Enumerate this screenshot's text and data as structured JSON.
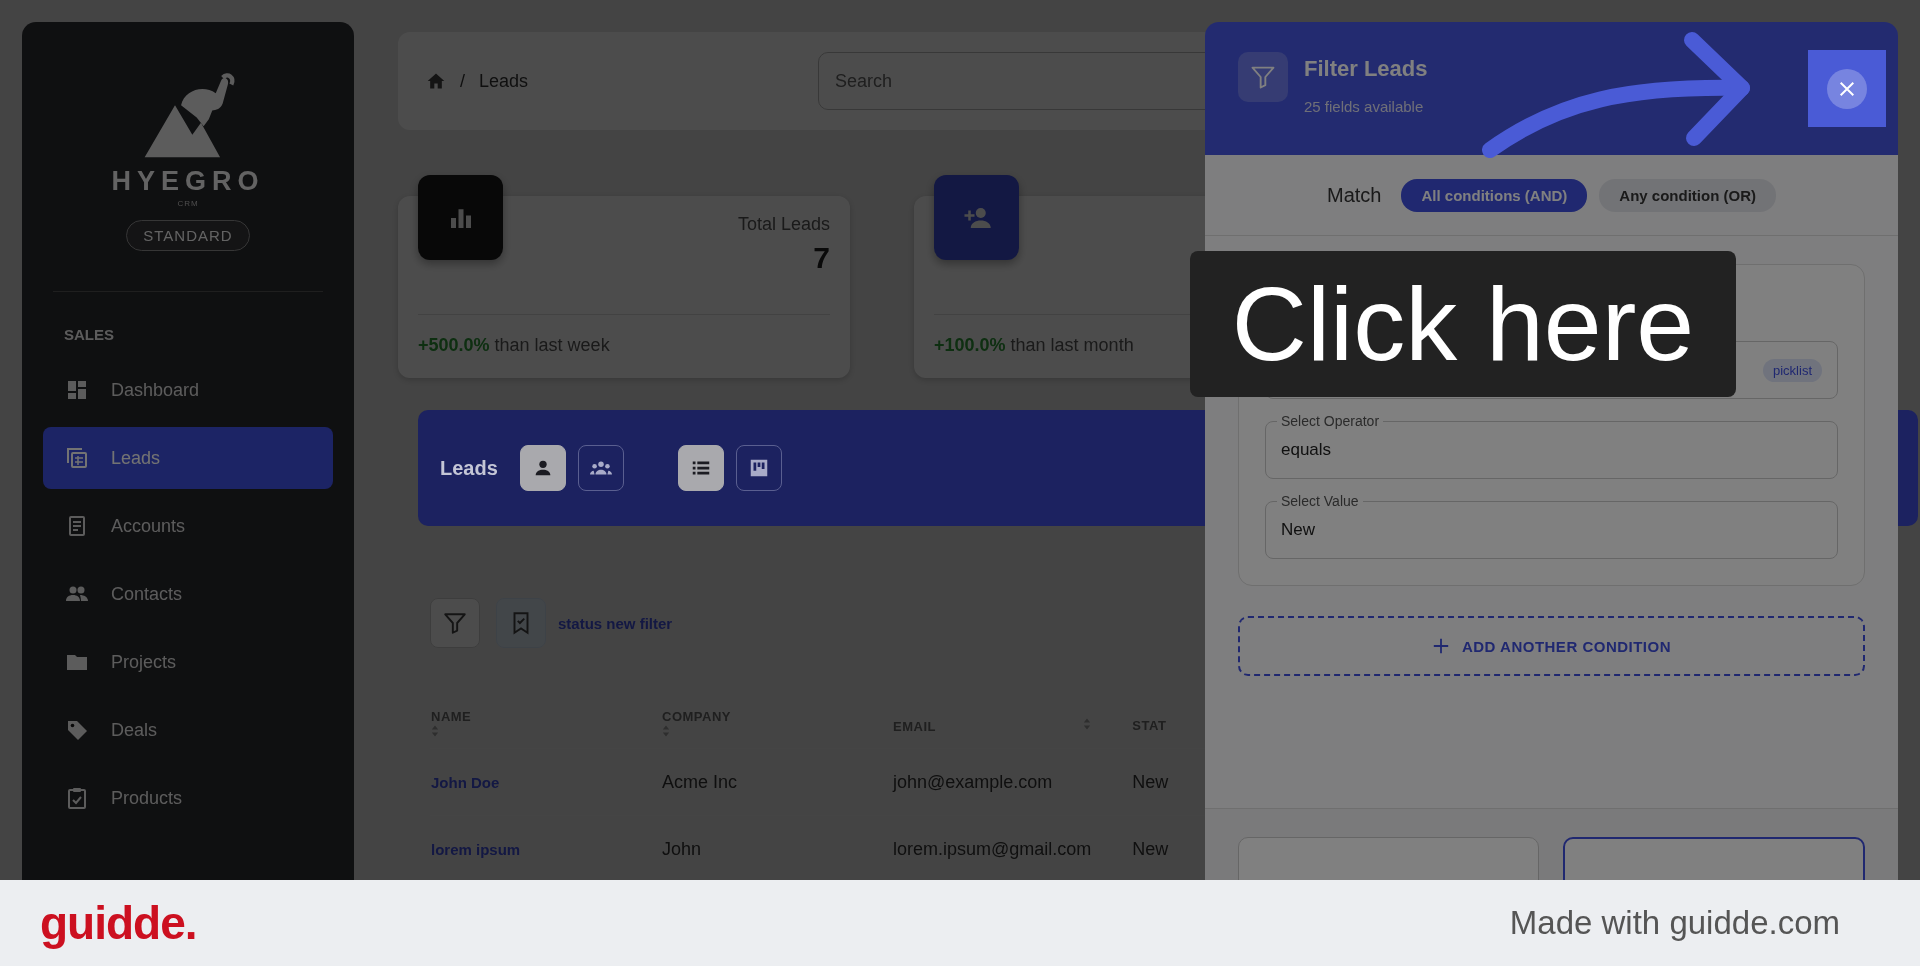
{
  "sidebar": {
    "brand": "HYEGRO",
    "brand_sub": "CRM",
    "plan": "STANDARD",
    "section": "SALES",
    "items": [
      {
        "label": "Dashboard",
        "selected": false
      },
      {
        "label": "Leads",
        "selected": true
      },
      {
        "label": "Accounts",
        "selected": false
      },
      {
        "label": "Contacts",
        "selected": false
      },
      {
        "label": "Projects",
        "selected": false
      },
      {
        "label": "Deals",
        "selected": false
      },
      {
        "label": "Products",
        "selected": false
      }
    ]
  },
  "breadcrumb": {
    "separator": "/",
    "current": "Leads"
  },
  "search": {
    "placeholder": "Search"
  },
  "stats": [
    {
      "label": "Total Leads",
      "value": "7",
      "change": "+500.0%",
      "period": "than last week"
    },
    {
      "change": "+100.0%",
      "period": "than last month"
    }
  ],
  "leads_bar": {
    "title": "Leads",
    "view_toggles": [
      {
        "selected": true
      },
      {
        "selected": false
      }
    ],
    "layout_toggles": [
      {
        "selected": true
      },
      {
        "selected": false
      }
    ]
  },
  "saved_filter": "status new filter",
  "table": {
    "columns": [
      "NAME",
      "COMPANY",
      "EMAIL",
      "STAT"
    ],
    "rows": [
      [
        "John Doe",
        "Acme Inc",
        "john@example.com",
        "New"
      ],
      [
        "lorem ipsum",
        "John",
        "lorem.ipsum@gmail.com",
        "New"
      ]
    ]
  },
  "filter_panel": {
    "title": "Filter Leads",
    "subtitle": "25 fields available",
    "match_label": "Match",
    "match_options": [
      {
        "label": "All conditions (AND)",
        "selected": true
      },
      {
        "label": "Any condition (OR)",
        "selected": false
      }
    ],
    "condition": {
      "field_type": "picklist",
      "operator_label": "Select Operator",
      "operator": "equals",
      "value_label": "Select Value",
      "value": "New"
    },
    "add_button": "ADD ANOTHER CONDITION"
  },
  "callout": "Click here",
  "footer": {
    "logo": "guidde.",
    "credit": "Made with guidde.com"
  }
}
